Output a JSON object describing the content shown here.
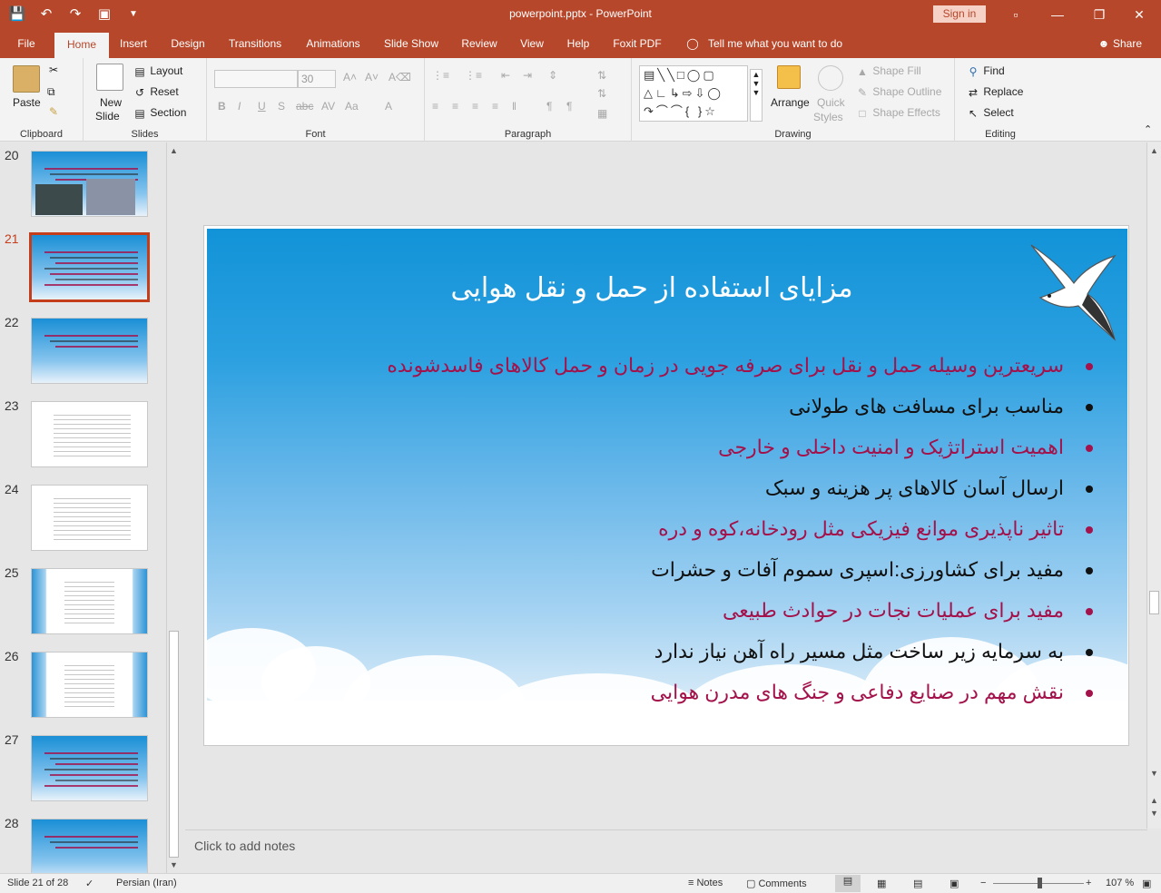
{
  "window": {
    "title": "powerpoint.pptx  -  PowerPoint",
    "sign_in": "Sign in"
  },
  "quick_access": [
    "save-icon",
    "undo-icon",
    "redo-icon",
    "present-icon",
    "customize-icon"
  ],
  "tabs": [
    "File",
    "Home",
    "Insert",
    "Design",
    "Transitions",
    "Animations",
    "Slide Show",
    "Review",
    "View",
    "Help",
    "Foxit PDF"
  ],
  "active_tab": "Home",
  "tell_me": "Tell me what you want to do",
  "share": "Share",
  "ribbon": {
    "clipboard": {
      "label": "Clipboard",
      "paste": "Paste"
    },
    "slides": {
      "label": "Slides",
      "new_slide_1": "New",
      "new_slide_2": "Slide",
      "layout": "Layout",
      "reset": "Reset",
      "section": "Section"
    },
    "font": {
      "label": "Font",
      "size": "30",
      "bold": "B",
      "italic": "I",
      "underline": "U",
      "shadow": "S",
      "strike": "abc",
      "spacing": "AV",
      "case": "Aa",
      "color": "A"
    },
    "paragraph": {
      "label": "Paragraph"
    },
    "drawing": {
      "label": "Drawing",
      "arrange": "Arrange",
      "quick_styles_1": "Quick",
      "quick_styles_2": "Styles",
      "shape_fill": "Shape Fill",
      "shape_outline": "Shape Outline",
      "shape_effects": "Shape Effects"
    },
    "editing": {
      "label": "Editing",
      "find": "Find",
      "replace": "Replace",
      "select": "Select"
    }
  },
  "thumbnails": [
    {
      "num": "20",
      "current": false,
      "style": "photo"
    },
    {
      "num": "21",
      "current": true,
      "style": "text"
    },
    {
      "num": "22",
      "current": false,
      "style": "short"
    },
    {
      "num": "23",
      "current": false,
      "style": "paper"
    },
    {
      "num": "24",
      "current": false,
      "style": "paper"
    },
    {
      "num": "25",
      "current": false,
      "style": "white"
    },
    {
      "num": "26",
      "current": false,
      "style": "white"
    },
    {
      "num": "27",
      "current": false,
      "style": "text"
    },
    {
      "num": "28",
      "current": false,
      "style": "short"
    }
  ],
  "slide": {
    "title": "مزایای استفاده از حمل و نقل هوایی",
    "bullets": [
      {
        "text": "سریعترین وسیله حمل و نقل برای صرفه جویی در زمان و حمل کالاهای فاسدشونده",
        "color": "#a3124b"
      },
      {
        "text": "مناسب برای مسافت های طولانی",
        "color": "#111111"
      },
      {
        "text": "اهمیت استراتژیک و امنیت داخلی و خارجی",
        "color": "#a3124b"
      },
      {
        "text": "ارسال آسان کالاهای پر هزینه و سبک",
        "color": "#111111"
      },
      {
        "text": "تاثیر ناپذیری موانع فیزیکی مثل رودخانه،کوه و دره",
        "color": "#a3124b"
      },
      {
        "text": "مفید برای کشاورزی:اسپری سموم آفات و حشرات",
        "color": "#111111"
      },
      {
        "text": "مفید برای عملیات نجات در حوادث طبیعی",
        "color": "#a3124b"
      },
      {
        "text": "به سرمایه زیر ساخت مثل مسیر راه آهن نیاز ندارد",
        "color": "#111111"
      },
      {
        "text": "نقش مهم در صنایع دفاعی و جنگ های مدرن هوایی",
        "color": "#a3124b"
      }
    ]
  },
  "notes_placeholder": "Click to add notes",
  "status": {
    "slide_counter": "Slide 21 of 28",
    "language": "Persian (Iran)",
    "notes": "Notes",
    "comments": "Comments",
    "zoom": "107 %",
    "zoom_level_percent": 107
  }
}
